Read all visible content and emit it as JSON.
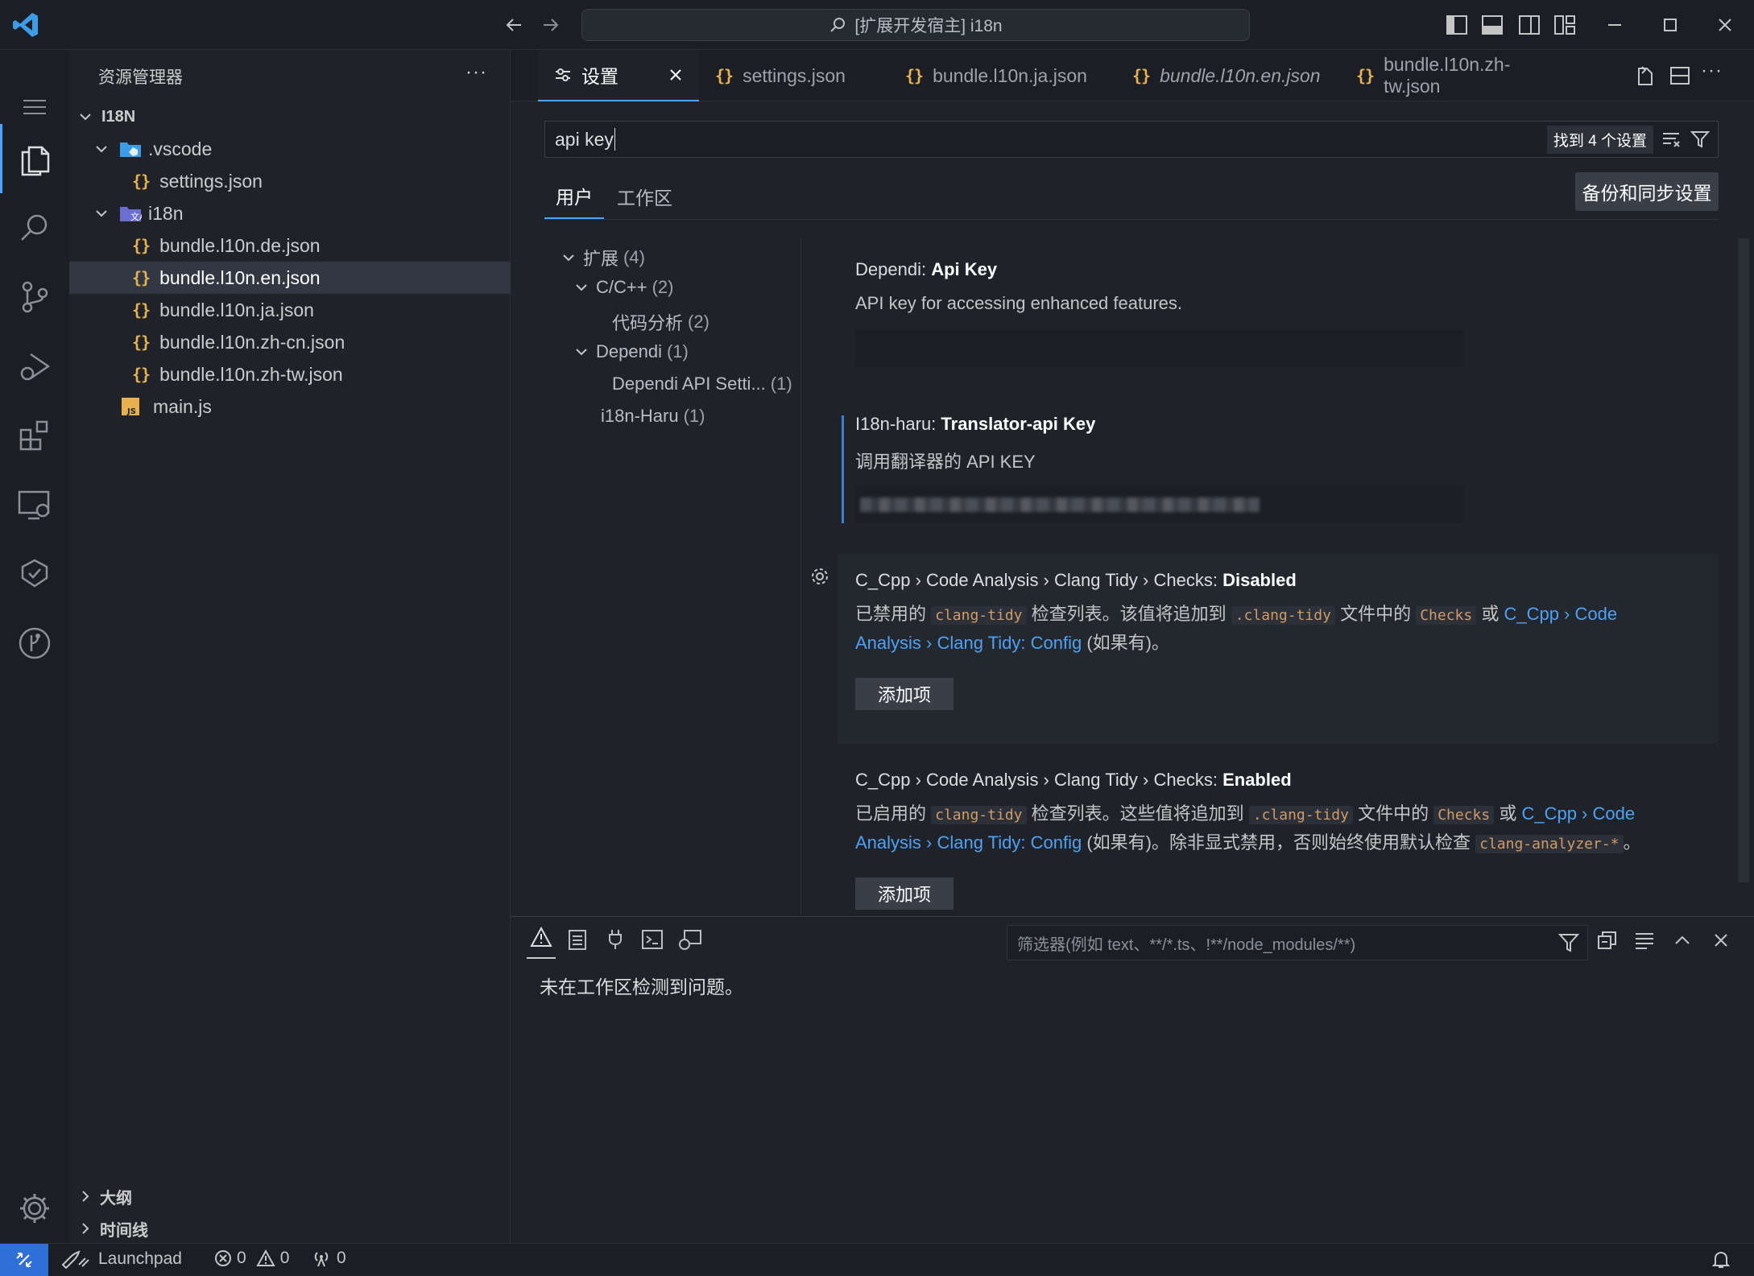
{
  "titlebar": {
    "command_center": "[扩展开发宿主] i18n",
    "back_icon": "arrow-left-icon",
    "forward_icon": "arrow-right-icon"
  },
  "sidebar": {
    "title": "资源管理器",
    "more": "···",
    "root": "I18N",
    "items": [
      {
        "label": ".vscode",
        "kind": "folder"
      },
      {
        "label": "settings.json",
        "kind": "json"
      },
      {
        "label": "i18n",
        "kind": "folder"
      },
      {
        "label": "bundle.l10n.de.json",
        "kind": "json"
      },
      {
        "label": "bundle.l10n.en.json",
        "kind": "json",
        "selected": true
      },
      {
        "label": "bundle.l10n.ja.json",
        "kind": "json"
      },
      {
        "label": "bundle.l10n.zh-cn.json",
        "kind": "json"
      },
      {
        "label": "bundle.l10n.zh-tw.json",
        "kind": "json"
      },
      {
        "label": "main.js",
        "kind": "js"
      }
    ],
    "outline": "大纲",
    "timeline": "时间线"
  },
  "tabs": [
    {
      "label": "设置",
      "active": true
    },
    {
      "label": "settings.json"
    },
    {
      "label": "bundle.l10n.ja.json"
    },
    {
      "label": "bundle.l10n.en.json",
      "italic": true
    },
    {
      "label": "bundle.l10n.zh-tw.json"
    }
  ],
  "settings": {
    "search_value": "api key",
    "result_count": "找到 4 个设置",
    "scope_user": "用户",
    "scope_workspace": "工作区",
    "sync_button": "备份和同步设置",
    "toc": [
      {
        "label": "扩展",
        "count": "(4)"
      },
      {
        "label": "C/C++",
        "count": "(2)"
      },
      {
        "label": "代码分析",
        "count": "(2)"
      },
      {
        "label": "Dependi",
        "count": "(1)"
      },
      {
        "label": "Dependi API Setti...",
        "count": "(1)"
      },
      {
        "label": "i18n-Haru",
        "count": "(1)"
      }
    ],
    "items": {
      "s1_prefix": "Dependi: ",
      "s1_name": "Api Key",
      "s1_desc": "API key for accessing enhanced features.",
      "s2_prefix": "I18n-haru: ",
      "s2_name": "Translator-api Key",
      "s2_desc": "调用翻译器的 API KEY",
      "s3_prefix": "C_Cpp › Code Analysis › Clang Tidy › Checks: ",
      "s3_name": "Disabled",
      "s3_desc_a": "已禁用的 ",
      "s3_code1": "clang-tidy",
      "s3_desc_b": " 检查列表。该值将追加到 ",
      "s3_code2": ".clang-tidy",
      "s3_desc_c": " 文件中的 ",
      "s3_code3": "Checks",
      "s3_desc_d": " 或 ",
      "s3_link1": "C_Cpp › Code",
      "s3_link2": "Analysis › Clang Tidy: Config",
      "s3_desc_e": " (如果有)。",
      "s3_button": "添加项",
      "s4_prefix": "C_Cpp › Code Analysis › Clang Tidy › Checks: ",
      "s4_name": "Enabled",
      "s4_desc_a": "已启用的 ",
      "s4_code1": "clang-tidy",
      "s4_desc_b": " 检查列表。这些值将追加到 ",
      "s4_code2": ".clang-tidy",
      "s4_desc_c": " 文件中的 ",
      "s4_code3": "Checks",
      "s4_desc_d": " 或 ",
      "s4_link1": "C_Cpp › Code",
      "s4_link2": "Analysis › Clang Tidy: Config",
      "s4_desc_e": " (如果有)。除非显式禁用，否则始终使用默认检查 ",
      "s4_code4": "clang-analyzer-*",
      "s4_desc_f": "。",
      "s4_button": "添加项"
    }
  },
  "panel": {
    "filter_placeholder": "筛选器(例如 text、**/*.ts、!**/node_modules/**)",
    "message": "未在工作区检测到问题。"
  },
  "status": {
    "launchpad": "Launchpad",
    "errors": "0",
    "warnings": "0",
    "ports": "0"
  },
  "colors": {
    "accent": "#4aa3ff",
    "json_icon": "#e8b14b",
    "link": "#4ea1f3",
    "remote": "#2f6fd8"
  }
}
